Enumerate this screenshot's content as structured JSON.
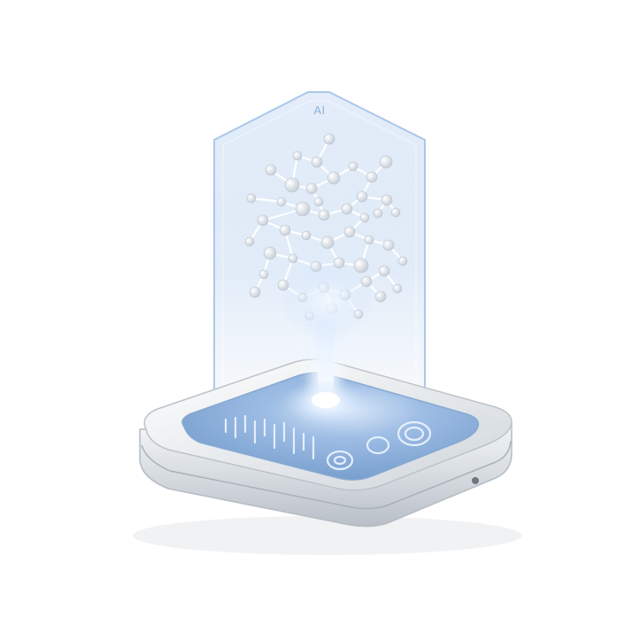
{
  "hologram": {
    "label": "AI"
  },
  "colors": {
    "hologram_glass": "#c9dcf3",
    "hologram_edge": "#8fb3da",
    "screen": "#7fa6d6",
    "device_body": "#e9ecef",
    "light_beam": "#ffffff"
  },
  "icons": {
    "molecule": "molecule-structure",
    "bars": "screen-bar-graph",
    "circles": "screen-circle-dials"
  }
}
